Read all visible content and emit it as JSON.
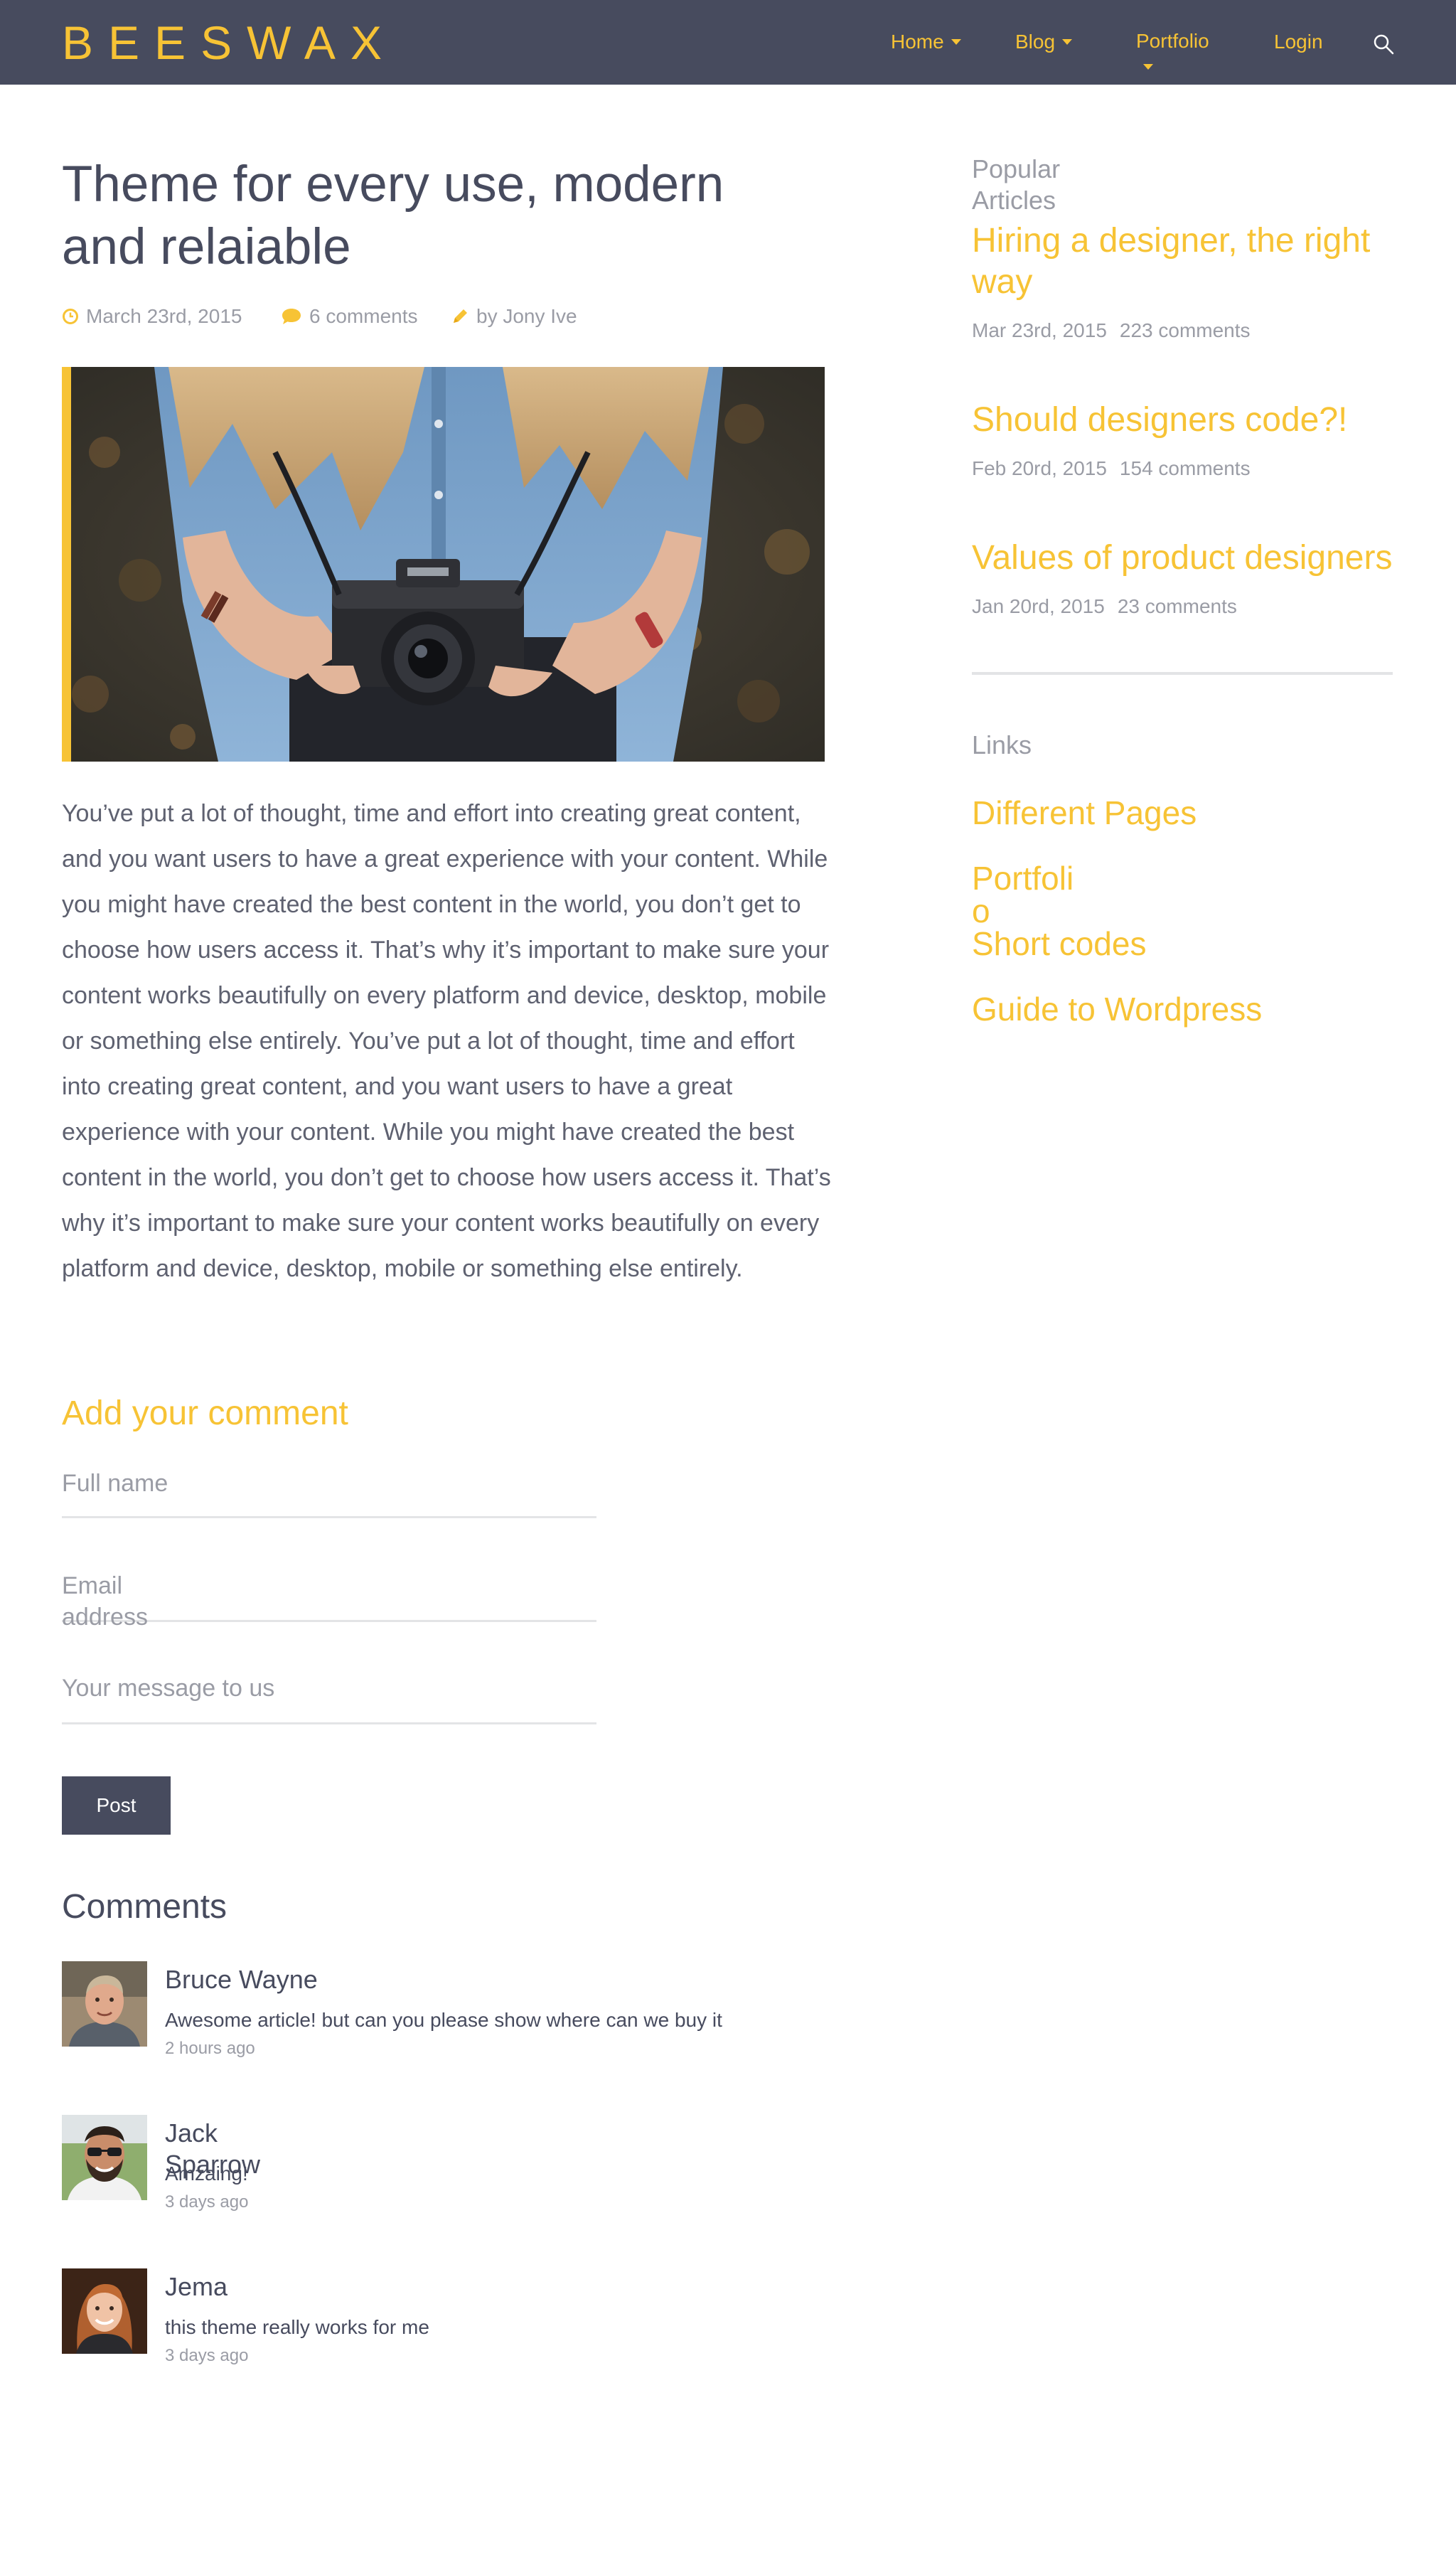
{
  "header": {
    "logo": "BEESWAX",
    "nav": {
      "home": "Home",
      "blog": "Blog",
      "portfolio": "Portfolio",
      "login": "Login"
    }
  },
  "article": {
    "title": "Theme for every use, modern and relaiable",
    "date": "March 23rd, 2015",
    "comments": "6 comments",
    "author": "by Jony Ive",
    "body": "You’ve put a lot of thought, time and effort into creating great content, and you want users to have a great experience with your content. While you might have created the best content in the world, you don’t get to choose how users access it. That’s why it’s important to make sure your content works beautifully on every platform and device, desktop, mobile or something else entirely. You’ve put a lot of thought, time and effort into creating great content, and you want users to have a great experience with your content. While you might have created the best content in the world, you don’t get to choose how users access it. That’s why it’s important to make sure your content works beautifully on every platform and device, desktop, mobile or something else entirely."
  },
  "form": {
    "title": "Add your comment",
    "full_name": "Full name",
    "email": "Email address",
    "message": "Your message to us",
    "post": "Post"
  },
  "comments": {
    "title": "Comments",
    "items": [
      {
        "name": "Bruce Wayne",
        "text": "Awesome article! but can you please show where can we buy it",
        "time": "2 hours ago"
      },
      {
        "name": "Jack Sparrow",
        "text": "Amzaing!",
        "time": "3 days ago"
      },
      {
        "name": "Jema",
        "text": "this theme really works for me",
        "time": "3 days ago"
      }
    ]
  },
  "sidebar": {
    "popular_title": "Popular Articles",
    "popular": [
      {
        "title": "Hiring a designer, the right way",
        "date": "Mar 23rd, 2015",
        "comments": "223 comments"
      },
      {
        "title": "Should designers code?!",
        "date": "Feb 20rd, 2015",
        "comments": "154 comments"
      },
      {
        "title": "Values of product designers",
        "date": "Jan 20rd, 2015",
        "comments": "23 comments"
      }
    ],
    "links_title": "Links",
    "links": [
      "Different Pages",
      "Portfolio",
      "Short codes",
      "Guide to Wordpress"
    ]
  },
  "colors": {
    "accent": "#f7c335",
    "header_bg": "#474b5e",
    "text_dark": "#474b5e",
    "text_muted": "#9a9ca5"
  }
}
